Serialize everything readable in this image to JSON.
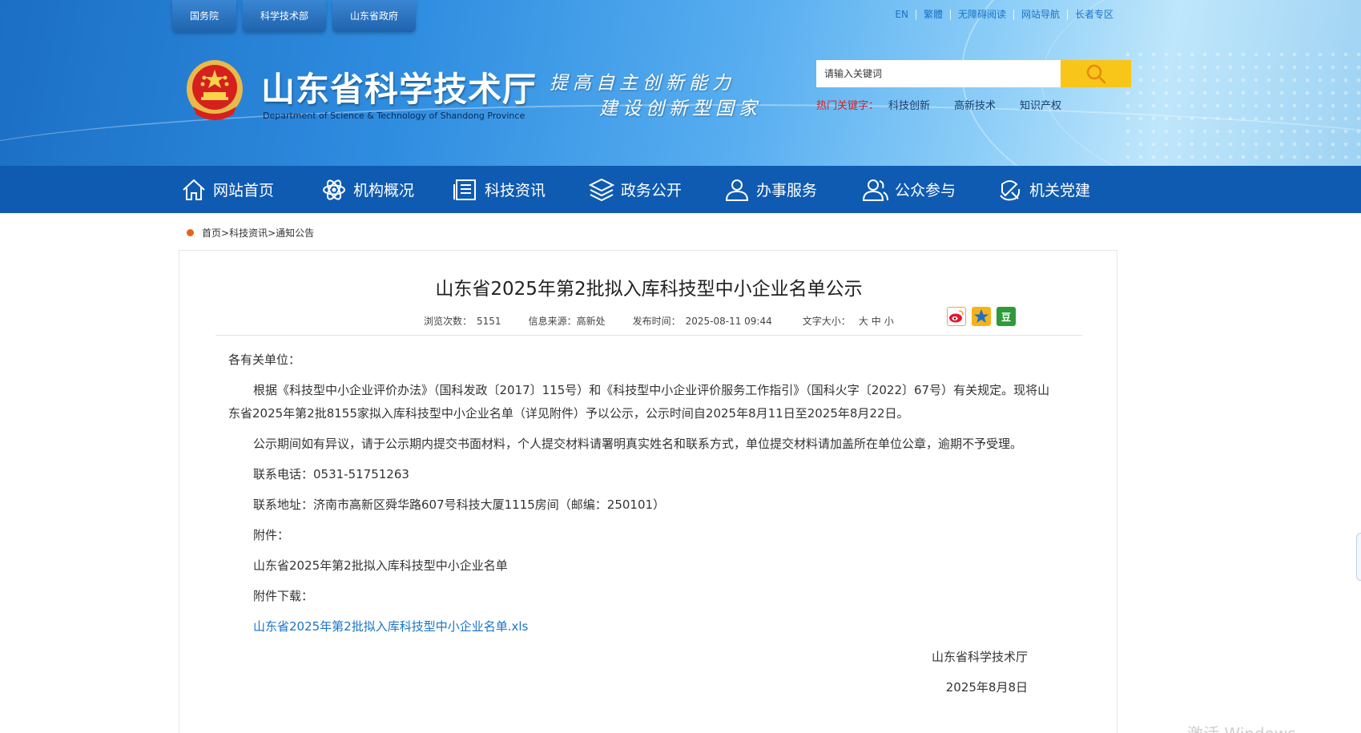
{
  "header": {
    "top_tabs": [
      "国务院",
      "科学技术部",
      "山东省政府"
    ],
    "top_links": [
      "EN",
      "繁體",
      "无障碍阅读",
      "网站导航",
      "长者专区"
    ],
    "site_title": "山东省科学技术厅",
    "site_subtitle": "Department of Science & Technology of Shandong Province",
    "slogan_line1": "提高自主创新能力",
    "slogan_line2": "建设创新型国家",
    "search_placeholder": "请输入关键词",
    "hot_label": "热门关键字：",
    "hot_keywords": [
      "科技创新",
      "高新技术",
      "知识产权"
    ]
  },
  "nav": [
    {
      "label": "网站首页",
      "icon": "home-icon"
    },
    {
      "label": "机构概况",
      "icon": "atom-icon"
    },
    {
      "label": "科技资讯",
      "icon": "news-icon"
    },
    {
      "label": "政务公开",
      "icon": "layers-icon"
    },
    {
      "label": "办事服务",
      "icon": "user-icon"
    },
    {
      "label": "公众参与",
      "icon": "users-icon"
    },
    {
      "label": "机关党建",
      "icon": "party-icon"
    }
  ],
  "breadcrumb": {
    "home": "首页",
    "section": "科技资讯",
    "current": "通知公告"
  },
  "article": {
    "title": "山东省2025年第2批拟入库科技型中小企业名单公示",
    "views_label": "浏览次数：",
    "views": "5151",
    "source_label": "信息来源：",
    "source": "高新处",
    "date_label": "发布时间：",
    "date": "2025-08-11 09:44",
    "font_label": "文字大小：",
    "font_sizes": [
      "大",
      "中",
      "小"
    ],
    "share": [
      "weibo-icon",
      "qzone-icon",
      "douban-icon"
    ],
    "douban_glyph": "豆",
    "salutation": "各有关单位：",
    "para1": "根据《科技型中小企业评价办法》（国科发政〔2017〕115号）和《科技型中小企业评价服务工作指引》（国科火字〔2022〕67号）有关规定。现将山东省2025年第2批8155家拟入库科技型中小企业名单（详见附件）予以公示，公示时间自2025年8月11日至2025年8月22日。",
    "para2": "公示期间如有异议，请于公示期内提交书面材料，个人提交材料请署明真实姓名和联系方式，单位提交材料请加盖所在单位公章，逾期不予受理。",
    "phone": "联系电话：0531-51751263",
    "address": "联系地址：济南市高新区舜华路607号科技大厦1115房间（邮编：250101）",
    "attach_label": "附件：",
    "attach_name": "山东省2025年第2批拟入库科技型中小企业名单",
    "download_label": "附件下载：",
    "download_link": "山东省2025年第2批拟入库科技型中小企业名单.xls",
    "signature": "山东省科学技术厅",
    "sign_date": "2025年8月8日"
  },
  "watermark": "激活 Windows",
  "colors": {
    "nav_bg": "#0f5bb2",
    "search_btn": "#f8c619",
    "hot_label": "#d8201e",
    "link": "#1a73c6",
    "bc_dot": "#e8621a"
  }
}
